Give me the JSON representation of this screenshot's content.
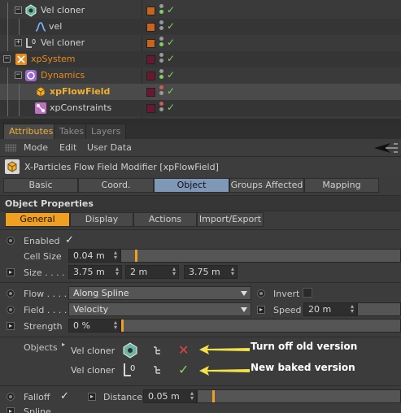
{
  "object_manager": {
    "rows": [
      {
        "label": "Vel cloner",
        "style": "normal",
        "swatch": "#c8641e",
        "dots": [
          "#9a9a9a",
          "#7fd35a"
        ],
        "check": "✓"
      },
      {
        "label": "vel",
        "style": "normal",
        "swatch": "#c8641e",
        "dots": [
          "#9a9a9a",
          "#9a9a9a"
        ],
        "check": "✓"
      },
      {
        "label": "Vel cloner",
        "style": "normal",
        "swatch": "#c8641e",
        "dots": [
          "#9a9a9a",
          "#7fd35a"
        ],
        "check": "✓"
      },
      {
        "label": "xpSystem",
        "style": "orange",
        "swatch": "#6a1832",
        "dots": [
          "#9a9a9a",
          "#9a9a9a"
        ],
        "check": "✓"
      },
      {
        "label": "Dynamics",
        "style": "orange",
        "swatch": "#6a1832",
        "dots": [
          "#9a9a9a",
          "#7fd35a"
        ],
        "check": "✓"
      },
      {
        "label": "xpFlowField",
        "style": "yellow",
        "swatch": "#6a1832",
        "dots": [
          "#d25a50",
          "#9a9a9a"
        ],
        "check": "✓"
      },
      {
        "label": "xpConstraints",
        "style": "normal",
        "swatch": "#6a1832",
        "dots": [
          "#d25a50",
          "#9a9a9a"
        ],
        "check": "✓"
      }
    ]
  },
  "panel_tabs": {
    "attributes": "Attributes",
    "takes": "Takes",
    "layers": "Layers"
  },
  "menubar": {
    "mode": "Mode",
    "edit": "Edit",
    "user_data": "User Data"
  },
  "object_header": {
    "title": "X-Particles Flow Field Modifier [xpFlowField]"
  },
  "section_tabs": {
    "basic": "Basic",
    "coord": "Coord.",
    "object": "Object",
    "groups_affected": "Groups Affected",
    "mapping": "Mapping"
  },
  "object_properties": {
    "title": "Object Properties",
    "subtabs": {
      "general": "General",
      "display": "Display",
      "actions": "Actions",
      "import_export": "Import/Export"
    },
    "enabled_label": "Enabled",
    "enabled_value": "✓",
    "cell_size_label": "Cell Size",
    "cell_size_value": "0.04 m",
    "size_label": "Size . . . .",
    "size_x": "3.75 m",
    "size_y": "2 m",
    "size_z": "3.75 m",
    "flow_label": "Flow . . . .",
    "flow_value": "Along Spline",
    "invert_label": "Invert",
    "field_label": "Field . . . .",
    "field_value": "Velocity",
    "speed_label": "Speed",
    "speed_value": "20 m",
    "strength_label": "Strength",
    "strength_value": "0 %",
    "objects_label": "Objects",
    "objects_list": [
      {
        "name": "Vel cloner",
        "status": "✕",
        "status_color": "#e04545",
        "annotation": "Turn off old version"
      },
      {
        "name": "Vel cloner",
        "status": "✓",
        "status_color": "#7fd35a",
        "annotation": "New baked version"
      }
    ],
    "falloff_label": "Falloff",
    "falloff_value": "✓",
    "distance_label": "Distance",
    "distance_value": "0.05 m",
    "spline_label": "Spline"
  },
  "colors": {
    "accent_orange": "#f0a020",
    "active_tab_blue": "#7f98b8",
    "annotation_arrow": "#f2e24a"
  }
}
